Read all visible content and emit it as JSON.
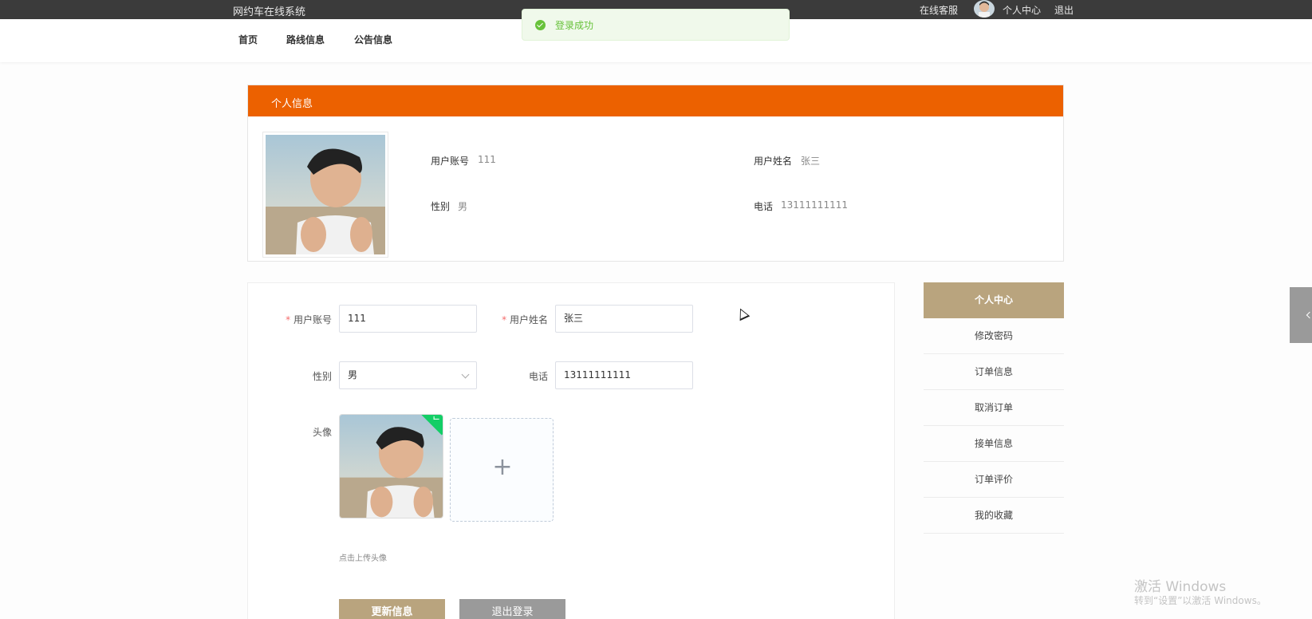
{
  "topbar": {
    "title": "网约车在线系统",
    "service": "在线客服",
    "personal_center": "个人中心",
    "logout": "退出"
  },
  "nav": {
    "items": [
      {
        "label": "首页"
      },
      {
        "label": "路线信息"
      },
      {
        "label": "公告信息"
      }
    ]
  },
  "toast": {
    "message": "登录成功"
  },
  "profile_card": {
    "header": "个人信息",
    "account_label": "用户账号",
    "account_value": "111",
    "name_label": "用户姓名",
    "name_value": "张三",
    "gender_label": "性别",
    "gender_value": "男",
    "phone_label": "电话",
    "phone_value": "13111111111"
  },
  "form": {
    "account_label": "用户账号",
    "account_value": "111",
    "name_label": "用户姓名",
    "name_value": "张三",
    "gender_label": "性别",
    "gender_value": "男",
    "phone_label": "电话",
    "phone_value": "13111111111",
    "avatar_label": "头像",
    "avatar_hint": "点击上传头像",
    "update_button": "更新信息",
    "logout_button": "退出登录",
    "required_mark": "*",
    "upload_plus": "+"
  },
  "side_menu": {
    "active": "个人中心",
    "items": [
      {
        "label": "修改密码"
      },
      {
        "label": "订单信息"
      },
      {
        "label": "取消订单"
      },
      {
        "label": "接单信息"
      },
      {
        "label": "订单评价"
      },
      {
        "label": "我的收藏"
      }
    ]
  },
  "watermark": {
    "line1": "激活 Windows",
    "line2": "转到“设置”以激活 Windows。"
  },
  "colors": {
    "topbar": "#3b3b3b",
    "header_orange": "#ec6100",
    "accent_tan": "#b9a47e",
    "success_green": "#67c23a",
    "logout_gray": "#9a9a9a"
  },
  "icons": {
    "toast": "check-circle-icon",
    "upload": "plus-icon",
    "uploaded": "check-icon",
    "select": "chevron-down-icon",
    "float_tab": "chevron-left-icon"
  }
}
